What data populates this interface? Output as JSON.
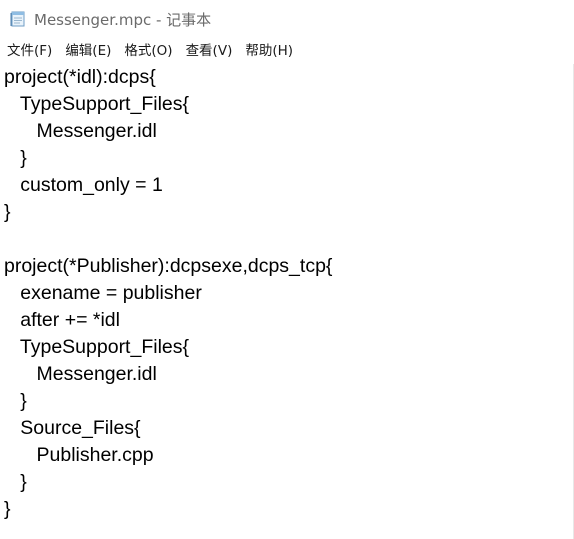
{
  "window": {
    "title": "Messenger.mpc - 记事本"
  },
  "menu": {
    "items": [
      {
        "label": "文件(F)"
      },
      {
        "label": "编辑(E)"
      },
      {
        "label": "格式(O)"
      },
      {
        "label": "查看(V)"
      },
      {
        "label": "帮助(H)"
      }
    ]
  },
  "editor": {
    "lines": [
      "project(*idl):dcps{",
      "   TypeSupport_Files{",
      "      Messenger.idl",
      "   }",
      "   custom_only = 1",
      "}",
      "",
      "project(*Publisher):dcpsexe,dcps_tcp{",
      "   exename = publisher",
      "   after += *idl",
      "   TypeSupport_Files{",
      "      Messenger.idl",
      "   }",
      "   Source_Files{",
      "      Publisher.cpp",
      "   }",
      "}"
    ]
  }
}
